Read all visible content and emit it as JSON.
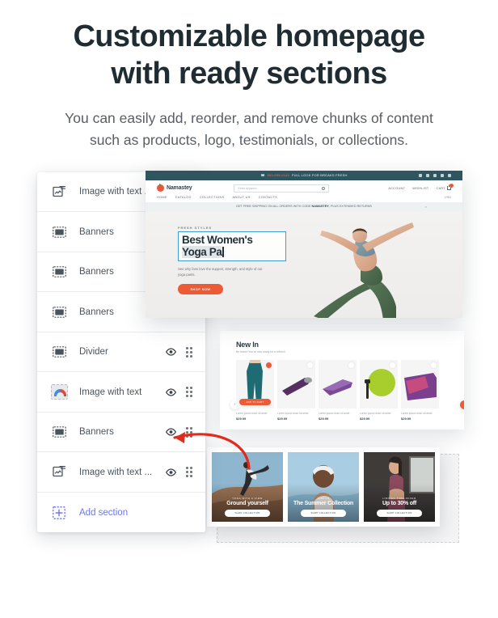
{
  "hero_copy": {
    "headline_line1": "Customizable homepage",
    "headline_line2": "with ready sections",
    "subhead_line1": "You can easily add, reorder, and remove",
    "subhead_line2": "chunks of content such as products, logo,",
    "subhead_line3": "testimonials, or collections."
  },
  "section_panel": {
    "rows": [
      {
        "label": "Image with text ...",
        "icon": "image-with-text-icon",
        "has_eye": false,
        "has_grip": false
      },
      {
        "label": "Banners",
        "icon": "banner-icon",
        "has_eye": false,
        "has_grip": false
      },
      {
        "label": "Banners",
        "icon": "banner-icon",
        "has_eye": false,
        "has_grip": false
      },
      {
        "label": "Banners",
        "icon": "banner-icon",
        "has_eye": false,
        "has_grip": false
      },
      {
        "label": "Divider",
        "icon": "banner-icon",
        "has_eye": true,
        "has_grip": true
      },
      {
        "label": "Image with text",
        "icon": "image-thumbnail-icon",
        "has_eye": true,
        "has_grip": true
      },
      {
        "label": "Banners",
        "icon": "banner-icon",
        "has_eye": true,
        "has_grip": true
      },
      {
        "label": "Image with text ...",
        "icon": "image-with-text-icon",
        "has_eye": true,
        "has_grip": true
      }
    ],
    "add_section_label": "Add section",
    "add_section_color": "#6e76e8"
  },
  "storefront": {
    "topbar": {
      "phone": "800-555-0142",
      "promo": "FULL LOOK FOR BREAKS FRESH"
    },
    "brand": "Namastey",
    "search_placeholder": "Enter keyword",
    "head_links": [
      "ACCOUNT",
      "WISHLIST",
      "CART"
    ],
    "cart_count": "2",
    "nav": [
      "HOME",
      "CATALOG",
      "COLLECTIONS",
      "ABOUT US",
      "CONTACTS"
    ],
    "nav_right": "USD",
    "shipping_text_pre": "GET FREE SHIPPING ON ALL ORDERS WITH CODE",
    "shipping_code": "NAMASTEY",
    "shipping_text_post": ", PLUS EXTENDED RETURNS",
    "shipping_close": "×",
    "hero": {
      "eyebrow": "FRESH STYLES",
      "title_line1": "Best Women's",
      "title_line2": "Yoga Pa",
      "description": "See why fans love the support, strength, and style of our yoga pants.",
      "cta": "SHOP NOW",
      "edit_outline_color": "#3f9ed6"
    }
  },
  "new_in": {
    "title": "New In",
    "subtitle": "Be brave! You're now ready for a refresh",
    "prev_arrow": "‹",
    "next_arrow": "›",
    "add_to_cart": "ADD TO CART",
    "products": [
      {
        "name": "Lorem ipsum dolor sit amet",
        "price": "$29.99",
        "favorite": true
      },
      {
        "name": "Lorem ipsum dolor sit amet",
        "price": "$29.99",
        "favorite": false
      },
      {
        "name": "Lorem ipsum dolor sit amet",
        "price": "$29.99",
        "favorite": false
      },
      {
        "name": "Lorem ipsum dolor sit amet",
        "price": "$29.99",
        "favorite": false
      },
      {
        "name": "Lorem ipsum dolor sit amet",
        "price": "$29.99",
        "favorite": false
      }
    ]
  },
  "banners": {
    "button_label": "SHOP COLLECTION",
    "cards": [
      {
        "eyebrow": "YOGA WITH A VIEW",
        "title": "Ground yourself"
      },
      {
        "eyebrow": "JUST IN",
        "title": "The Summer Collection"
      },
      {
        "eyebrow": "LIMITED TIME OFFER",
        "title": "Up to 30% off"
      }
    ]
  },
  "annotation": {
    "arrow_color": "#e02b1d"
  }
}
